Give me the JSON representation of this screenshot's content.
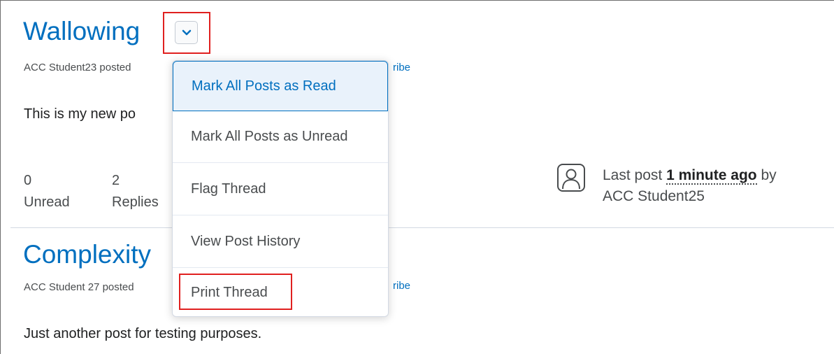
{
  "threads": [
    {
      "title": "Wallowing",
      "meta_visible": "ACC Student23 posted",
      "meta_tail": "ribe",
      "body": "This is my new po",
      "unread_count": "0",
      "unread_label": "Unread",
      "replies_count": "2",
      "replies_label": "Replies",
      "last_post_prefix": "Last post",
      "last_post_time": "1 minute ago",
      "last_post_by": "by",
      "last_post_author": "ACC Student25"
    },
    {
      "title": "Complexity",
      "meta_visible": "ACC Student 27 posted",
      "meta_tail": "ribe",
      "body": "Just another post for testing purposes."
    }
  ],
  "context_menu": {
    "items": [
      {
        "label": "Mark All Posts as Read"
      },
      {
        "label": "Mark All Posts as Unread"
      },
      {
        "label": "Flag Thread"
      },
      {
        "label": "View Post History"
      },
      {
        "label": "Print Thread"
      }
    ]
  },
  "icons": {
    "menu_toggle": "chevron-down-icon",
    "avatar": "user-avatar-icon"
  },
  "colors": {
    "link": "#006fbf",
    "highlight_box": "#e0201f",
    "menu_active_bg": "#e9f2fb"
  }
}
